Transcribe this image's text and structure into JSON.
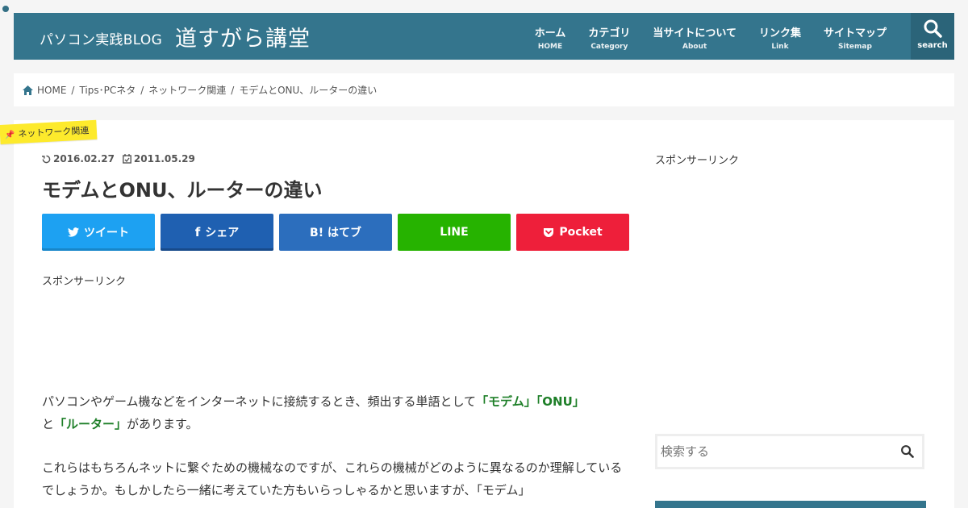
{
  "header": {
    "site_sub": "パソコン実践BLOG",
    "site_title": "道すがら講堂",
    "nav": [
      {
        "label": "ホーム",
        "sub": "HOME"
      },
      {
        "label": "カテゴリ",
        "sub": "Category"
      },
      {
        "label": "当サイトについて",
        "sub": "About"
      },
      {
        "label": "リンク集",
        "sub": "Link"
      },
      {
        "label": "サイトマップ",
        "sub": "Sitemap"
      }
    ],
    "search_label": "search",
    "icon": "search-icon"
  },
  "breadcrumb": [
    {
      "label": "HOME",
      "icon": "home-icon"
    },
    {
      "label": "Tips･PCネタ"
    },
    {
      "label": "ネットワーク関連"
    },
    {
      "label": "モデムとONU、ルーターの違い"
    }
  ],
  "breadcrumb_separator": "/",
  "article": {
    "category": "ネットワーク関連",
    "updated": "2016.02.27",
    "published": "2011.05.29",
    "title": "モデムとONU、ルーターの違い",
    "share": {
      "tweet": "ツイート",
      "share": "シェア",
      "hatebu": "B! はてブ",
      "line": "LINE",
      "pocket": "Pocket"
    },
    "sponsor": "スポンサーリンク",
    "para1": {
      "text_a": "パソコンやゲーム機などをインターネットに接続するとき、頻出する単語として",
      "hl1": "「モデム」",
      "hl2": "「ONU」",
      "text_b": "と",
      "hl3": "「ルーター」",
      "text_c": "があります。"
    },
    "para2": "これらはもちろんネットに繋ぐための機械なのですが、これらの機械がどのように異なるのか理解しているでしょうか。もしかしたら一緒に考えていた方もいらっしゃるかと思いますが、「モデム」"
  },
  "sidebar": {
    "sponsor": "スポンサーリンク",
    "search_placeholder": "検索する"
  },
  "colors": {
    "header": "#34758d",
    "category_tag": "#fdea2c",
    "highlight": "#1e7f28",
    "tweet": "#1da1f2",
    "share": "#1f60b1",
    "hatebu": "#2c6ebd",
    "line": "#26b300",
    "pocket": "#ee1f3a"
  }
}
